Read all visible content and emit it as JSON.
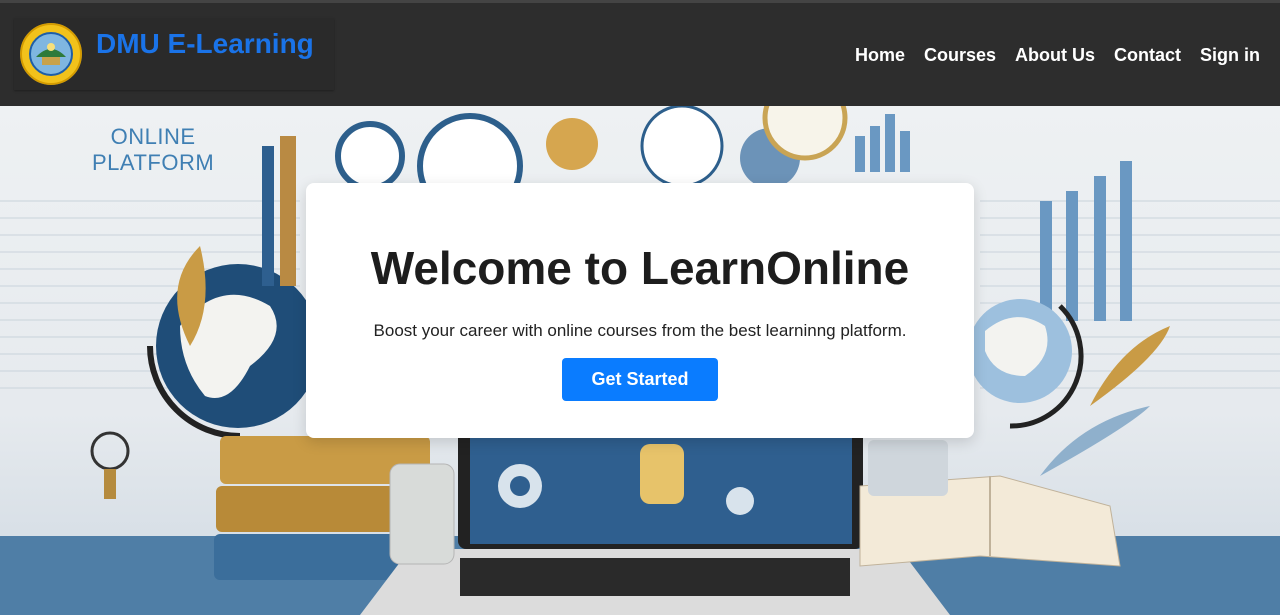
{
  "header": {
    "brand": "DMU E-Learning",
    "nav": [
      "Home",
      "Courses",
      "About Us",
      "Contact",
      "Sign in"
    ]
  },
  "hero": {
    "tag_line1": "ONLINE",
    "tag_line2": "PLATFORM",
    "title": "Welcome to LearnOnline",
    "subtitle": "Boost your career with online courses from the best learninng platform.",
    "cta": "Get Started"
  },
  "colors": {
    "header_bg": "#2d2d2d",
    "brand": "#1a73e8",
    "cta": "#0a7cff"
  }
}
